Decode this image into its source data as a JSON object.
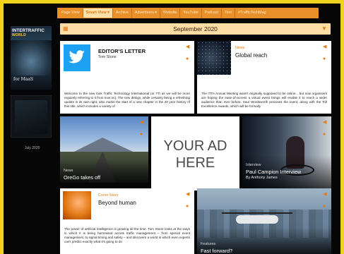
{
  "nav": {
    "items": [
      "Page View",
      "Smart View ▾",
      "Archive",
      "Advertisers ▾",
      "Website",
      "YouTube",
      "Podcast",
      "Text",
      "#TrafficTechMag"
    ],
    "active_index": 1
  },
  "sidebar": {
    "cover_mast_line1": "INTERTRAFFIC",
    "cover_mast_line2": "WORLD",
    "cover_line": "for MaaS",
    "issue_date": "July 2020"
  },
  "calendar": {
    "title": "September 2020"
  },
  "cards": {
    "editor": {
      "title": "EDITOR'S LETTER",
      "author": "Tom Stone",
      "body": "Welcome to the new look Traffic Technology International (or TTi as we will be more regularly referring to it from now on). The new design, while certainly being a refreshing update in its own right, also marks the start of a new chapter in the 20 year history of this title, which includes a variety of"
    },
    "global": {
      "label": "News",
      "title": "Global reach",
      "body": "The ITTA Annual Meeting wasn't originally supposed to be online... but now organisers are hoping the ease-of-access a virtual event brings will enable it to reach a wider audience than ever before. Saul Wordsworth previews the event, along with the Toll Excellence Awards, which will be formally"
    },
    "oregon": {
      "label": "News",
      "title": "OreGo takes off"
    },
    "ad": {
      "line1": "YOUR AD",
      "line2": "HERE"
    },
    "paul": {
      "label": "Interview",
      "title": "Paul Campion Interview",
      "author": "By Anthony James"
    },
    "cover_story": {
      "label": "Cover Story",
      "title": "Beyond human",
      "body": "The power of artificial intelligence is growing all the time. Tom Stone looks at the ways in which it is being harnessed across traffic management – from special event management, to signal timing and safety – and discovers a world in which even experts can't predict exactly what it's going to do"
    },
    "fast": {
      "label": "Features",
      "title": "Fast forward?"
    }
  },
  "icons": {
    "speaker": "speaker-icon",
    "more": "more-icon",
    "calendar_left": "calendar-icon",
    "calendar_right": "filter-icon"
  },
  "colors": {
    "frame": "#f2d21c",
    "accent": "#e37a16",
    "nav_active_bg": "#ffdfa8",
    "nav_bar": "#e9902a",
    "calendar_bar": "#ffdda5"
  }
}
